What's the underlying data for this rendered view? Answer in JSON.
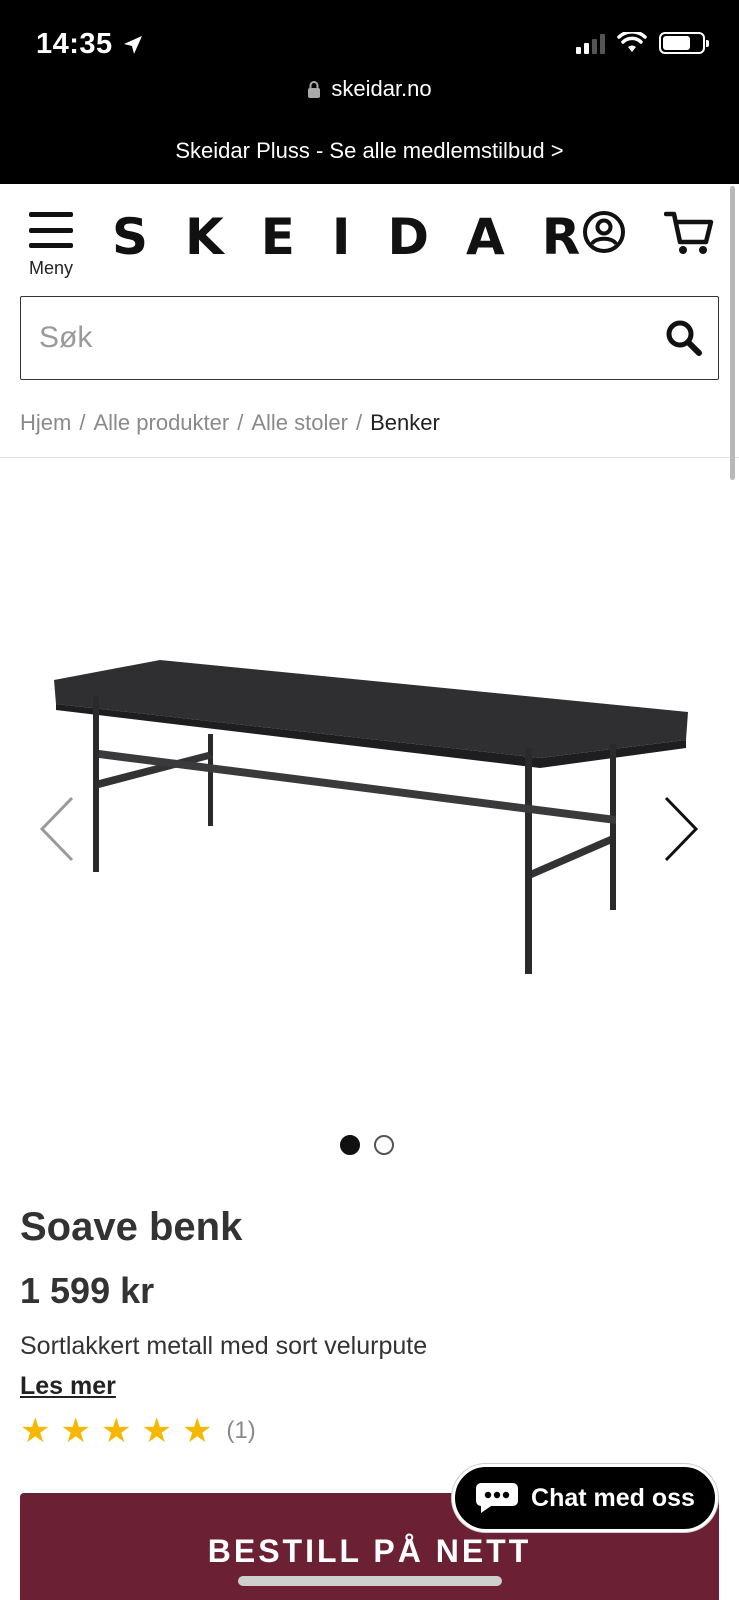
{
  "status_bar": {
    "time": "14:35"
  },
  "browser": {
    "url": "skeidar.no"
  },
  "promo_banner": {
    "text": "Skeidar Pluss - Se alle medlemstilbud >"
  },
  "header": {
    "menu_label": "Meny",
    "logo": "SKEIDAR"
  },
  "search": {
    "placeholder": "Søk"
  },
  "breadcrumb": {
    "items": [
      "Hjem",
      "Alle produkter",
      "Alle stoler"
    ],
    "separator": "/",
    "current": "Benker"
  },
  "product": {
    "title": "Soave benk",
    "price": "1 599 kr",
    "description": "Sortlakkert metall med sort velurpute",
    "read_more": "Les mer",
    "rating": 5,
    "rating_count": "(1)",
    "image_count": 2,
    "active_image": 1
  },
  "actions": {
    "order_label": "BESTILL PÅ NETT",
    "chat_label": "Chat med oss"
  },
  "colors": {
    "order_button": "#6b2033",
    "star": "#f5b800",
    "chrome": "#000000"
  }
}
